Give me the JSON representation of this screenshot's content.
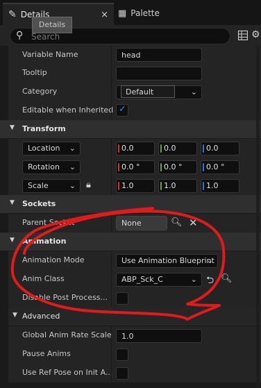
{
  "tabs": {
    "details": {
      "label": "Details",
      "close": "×"
    },
    "palette": {
      "label": "Palette"
    }
  },
  "tooltip": {
    "text": "Details"
  },
  "search": {
    "placeholder": "Search",
    "value": ""
  },
  "top_rows": {
    "variable_name": {
      "label": "Variable Name",
      "value": "head"
    },
    "tooltip": {
      "label": "Tooltip",
      "value": ""
    },
    "category": {
      "label": "Category",
      "value": "Default"
    },
    "editable_when_inherited": {
      "label": "Editable when Inherited",
      "checked": true
    }
  },
  "transform": {
    "title": "Transform",
    "location": {
      "mode": "Location",
      "x": "0.0",
      "y": "0.0",
      "z": "0.0"
    },
    "rotation": {
      "mode": "Rotation",
      "x": "0.0 °",
      "y": "0.0 °",
      "z": "0.0 °"
    },
    "scale": {
      "mode": "Scale",
      "x": "1.0",
      "y": "1.0",
      "z": "1.0",
      "locked": true
    }
  },
  "sockets": {
    "title": "Sockets",
    "parent_socket": {
      "label": "Parent Socket",
      "value": "None"
    }
  },
  "animation": {
    "title": "Animation",
    "mode": {
      "label": "Animation Mode",
      "value": "Use Animation Blueprint"
    },
    "anim_class": {
      "label": "Anim Class",
      "value": "ABP_Sck_C"
    },
    "disable_post_process": {
      "label": "Disable Post Process...",
      "checked": false
    }
  },
  "advanced": {
    "title": "Advanced",
    "global_anim_rate_scale": {
      "label": "Global Anim Rate Scale",
      "value": "1.0"
    },
    "pause_anims": {
      "label": "Pause Anims",
      "checked": false
    },
    "use_ref_pose": {
      "label": "Use Ref Pose on Init A...",
      "checked": false
    }
  },
  "colors": {
    "axis_x": "#c43a2c",
    "axis_y": "#6ca51f",
    "axis_z": "#2b77d8",
    "check_accent": "#2f8cff",
    "annotation_red": "#e01b1b"
  }
}
